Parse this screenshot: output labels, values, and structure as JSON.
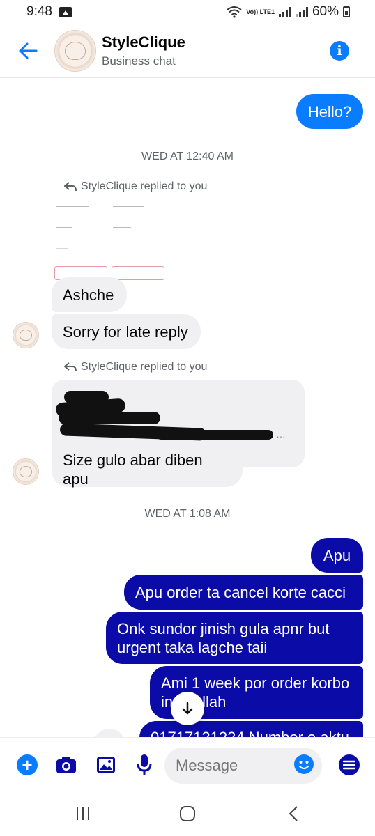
{
  "status_bar": {
    "time": "9:48",
    "network_label": "Vo)) LTE1",
    "battery": "60%"
  },
  "header": {
    "name": "StyleClique",
    "subtitle": "Business chat"
  },
  "messages": {
    "hello": "Hello?",
    "timestamp_1": "WED AT 12:40 AM",
    "reply_label_1": "StyleClique replied to you",
    "ashche": "Ashche",
    "sorry": "Sorry for late reply",
    "reply_label_2": "StyleClique replied to you",
    "size": "Size gulo abar diben apu",
    "timestamp_2": "WED AT 1:08 AM",
    "apu": "Apu",
    "cancel": "Apu order ta cancel korte cacci",
    "onk_line1": "Onk sundor jinish gula apnr but",
    "onk_line2": "urgent taka lagche taii",
    "ami_line1": "Ami 1 week por order korbo",
    "ami_line2": "in",
    "ami_line2b": "llah",
    "partial": "01717121224 Number e aktu"
  },
  "composer": {
    "placeholder": "Message"
  },
  "colors": {
    "accent_blue": "#0a7cff",
    "outgoing_navy": "#0b0ba8",
    "incoming_grey": "#f0f0f2"
  }
}
